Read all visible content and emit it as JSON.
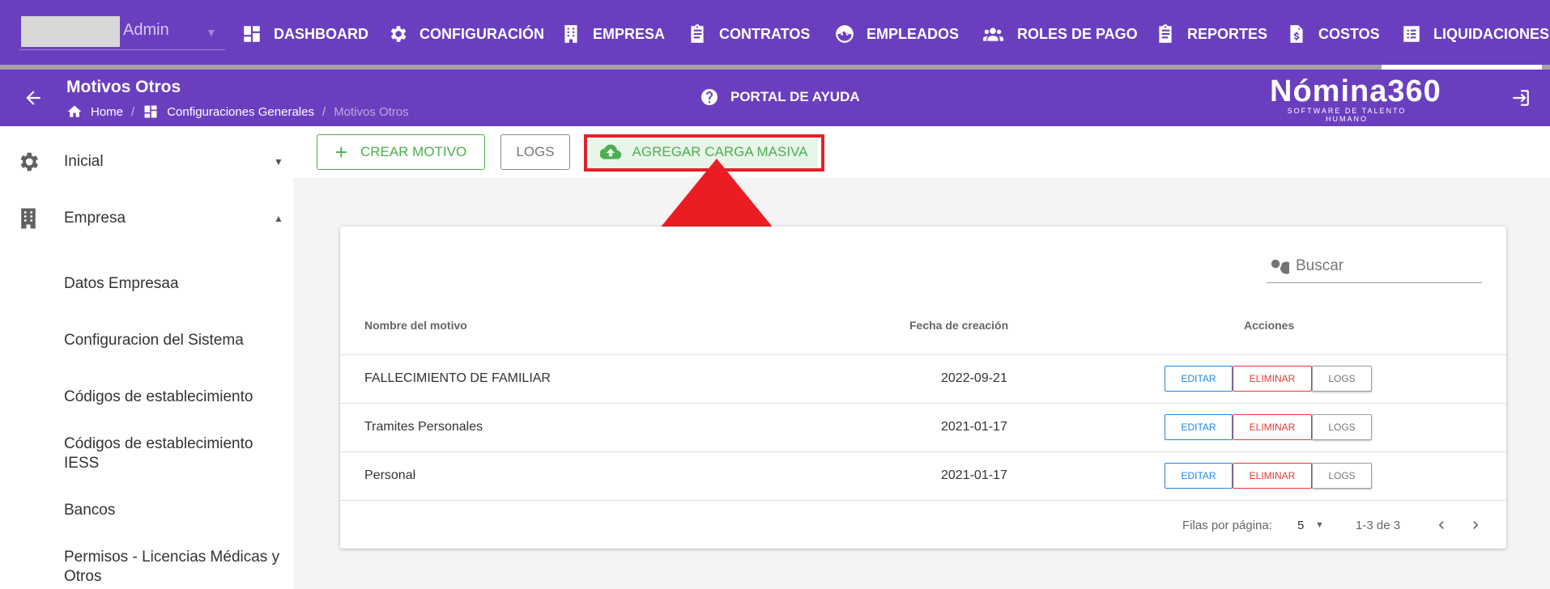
{
  "topnav": {
    "user": "Admin",
    "items": [
      "DASHBOARD",
      "CONFIGURACIÓN",
      "EMPRESA",
      "CONTRATOS",
      "EMPLEADOS",
      "ROLES DE PAGO",
      "REPORTES",
      "COSTOS",
      "LIQUIDACIONES"
    ]
  },
  "header": {
    "title": "Motivos Otros",
    "breadcrumb": [
      "Home",
      "Configuraciones Generales",
      "Motivos Otros"
    ],
    "help": "PORTAL DE AYUDA",
    "brand": "Nómina360",
    "brand_tagline": "SOFTWARE DE TALENTO HUMANO"
  },
  "sidebar": {
    "groups": [
      "Inicial",
      "Empresa"
    ],
    "items": [
      "Datos Empresaa",
      "Configuracion del Sistema",
      "Códigos de establecimiento",
      "Códigos de establecimiento IESS",
      "Bancos",
      "Permisos - Licencias Médicas y Otros"
    ]
  },
  "toolbar": {
    "crear": "CREAR MOTIVO",
    "logs": "LOGS",
    "carga": "AGREGAR CARGA MASIVA"
  },
  "table": {
    "search_placeholder": "Buscar",
    "headers": [
      "Nombre del motivo",
      "Fecha de creación",
      "Acciones"
    ],
    "rows": [
      {
        "name": "FALLECIMIENTO DE FAMILIAR",
        "date": "2022-09-21"
      },
      {
        "name": "Tramites Personales",
        "date": "2021-01-17"
      },
      {
        "name": "Personal",
        "date": "2021-01-17"
      }
    ],
    "actions": [
      "EDITAR",
      "ELIMINAR",
      "LOGS"
    ],
    "footer": {
      "rows_label": "Filas por página:",
      "rows_value": "5",
      "range": "1-3 de 3"
    }
  },
  "colors": {
    "primary": "#6a3fbf",
    "success": "#4caf50",
    "danger": "#e53935",
    "info": "#1e88e5",
    "annotation": "#e5202a"
  }
}
